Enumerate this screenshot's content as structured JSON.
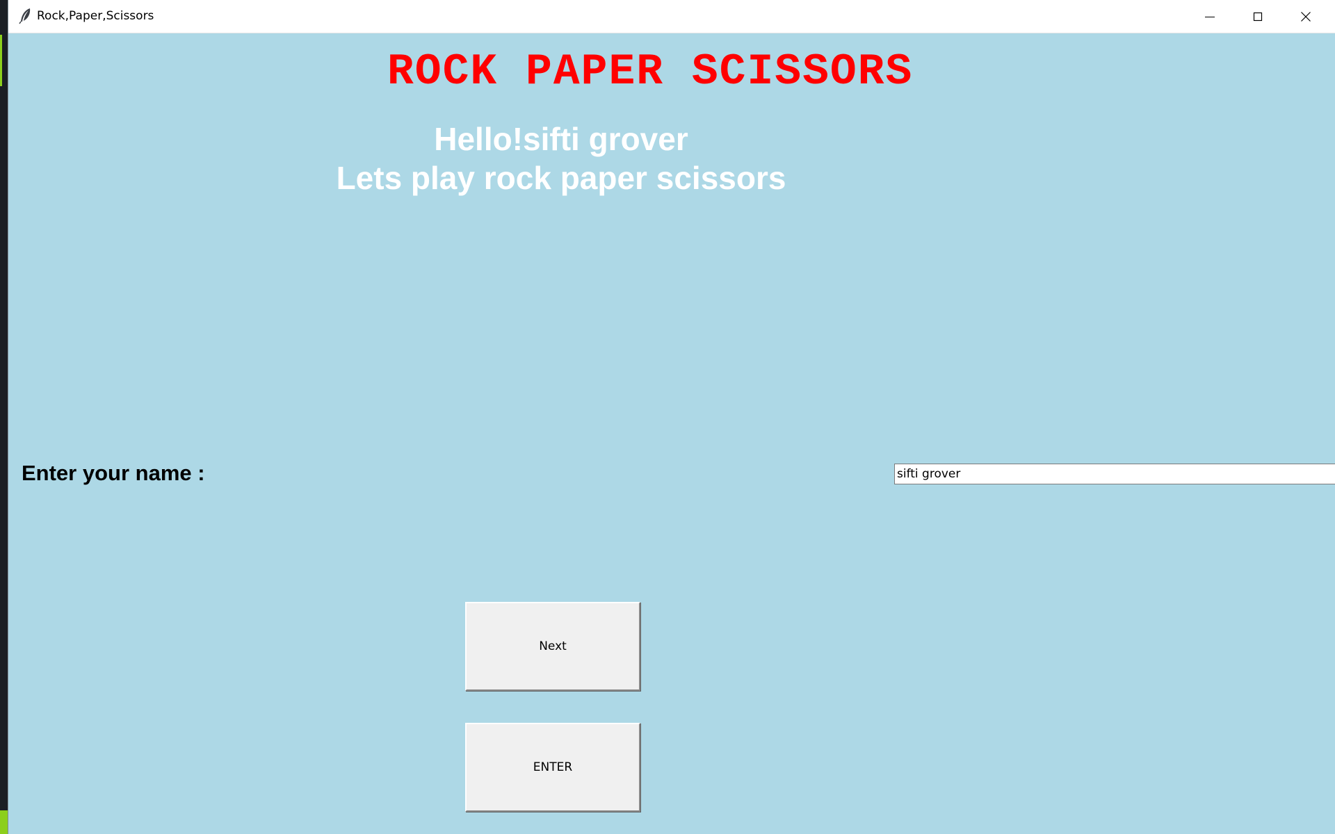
{
  "window": {
    "title": "Rock,Paper,Scissors",
    "app_icon": "feather-icon",
    "controls": {
      "minimize_icon": "minimize-icon",
      "maximize_icon": "maximize-icon",
      "close_icon": "close-icon"
    }
  },
  "content": {
    "heading": "ROCK PAPER SCISSORS",
    "greeting_line1": "Hello!sifti grover",
    "greeting_line2": "Lets play rock paper scissors",
    "name_label": "Enter your name :",
    "name_input_value": "sifti grover",
    "next_button_label": "Next",
    "enter_button_label": "ENTER"
  },
  "colors": {
    "background": "#add8e6",
    "heading": "#ff0000",
    "greeting": "#ffffff",
    "button_face": "#f0f0f0"
  }
}
